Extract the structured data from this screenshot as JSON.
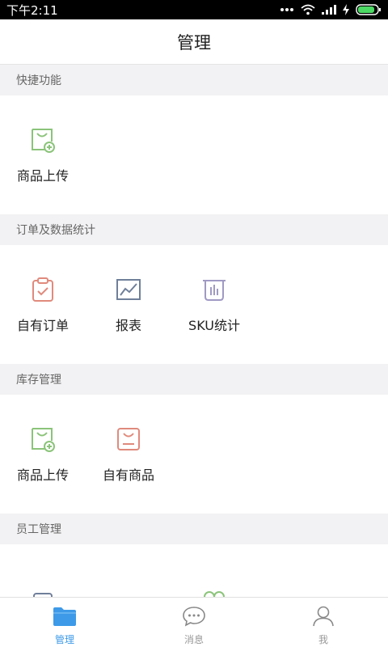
{
  "status_bar": {
    "time": "下午2:11"
  },
  "header": {
    "title": "管理"
  },
  "sections": [
    {
      "title": "快捷功能",
      "items": [
        {
          "label": "商品上传",
          "icon": "bag-plus-icon"
        }
      ]
    },
    {
      "title": "订单及数据统计",
      "items": [
        {
          "label": "自有订单",
          "icon": "clipboard-check-icon"
        },
        {
          "label": "报表",
          "icon": "line-chart-icon"
        },
        {
          "label": "SKU统计",
          "icon": "bar-bin-icon"
        }
      ]
    },
    {
      "title": "库存管理",
      "items": [
        {
          "label": "商品上传",
          "icon": "bag-plus-icon"
        },
        {
          "label": "自有商品",
          "icon": "bag-smile-icon"
        }
      ]
    },
    {
      "title": "员工管理",
      "items": []
    }
  ],
  "tabs": [
    {
      "label": "管理",
      "icon": "folder-icon",
      "active": true
    },
    {
      "label": "消息",
      "icon": "chat-bubble-icon",
      "active": false
    },
    {
      "label": "我",
      "icon": "person-icon",
      "active": false
    }
  ],
  "colors": {
    "accent": "#3d9ae8",
    "green_icon": "#8bc47a",
    "red_icon": "#e08a7c",
    "slate_icon": "#6f7f9a",
    "purple_icon": "#a09ac4"
  }
}
